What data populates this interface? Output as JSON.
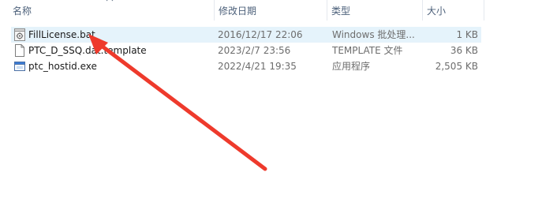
{
  "columns": {
    "name": "名称",
    "date": "修改日期",
    "type": "类型",
    "size": "大小"
  },
  "files": [
    {
      "name": "FillLicense.bat",
      "date": "2016/12/17 22:06",
      "type": "Windows 批处理...",
      "size": "1 KB",
      "icon": "batch-file-icon",
      "selected": true
    },
    {
      "name": "PTC_D_SSQ.dat.template",
      "date": "2023/2/7 23:56",
      "type": "TEMPLATE 文件",
      "size": "36 KB",
      "icon": "document-file-icon",
      "selected": false
    },
    {
      "name": "ptc_hostid.exe",
      "date": "2022/4/21 19:35",
      "type": "应用程序",
      "size": "2,505 KB",
      "icon": "application-exe-icon",
      "selected": false
    }
  ],
  "annotation": {
    "arrow_color": "#ee3a2c"
  }
}
